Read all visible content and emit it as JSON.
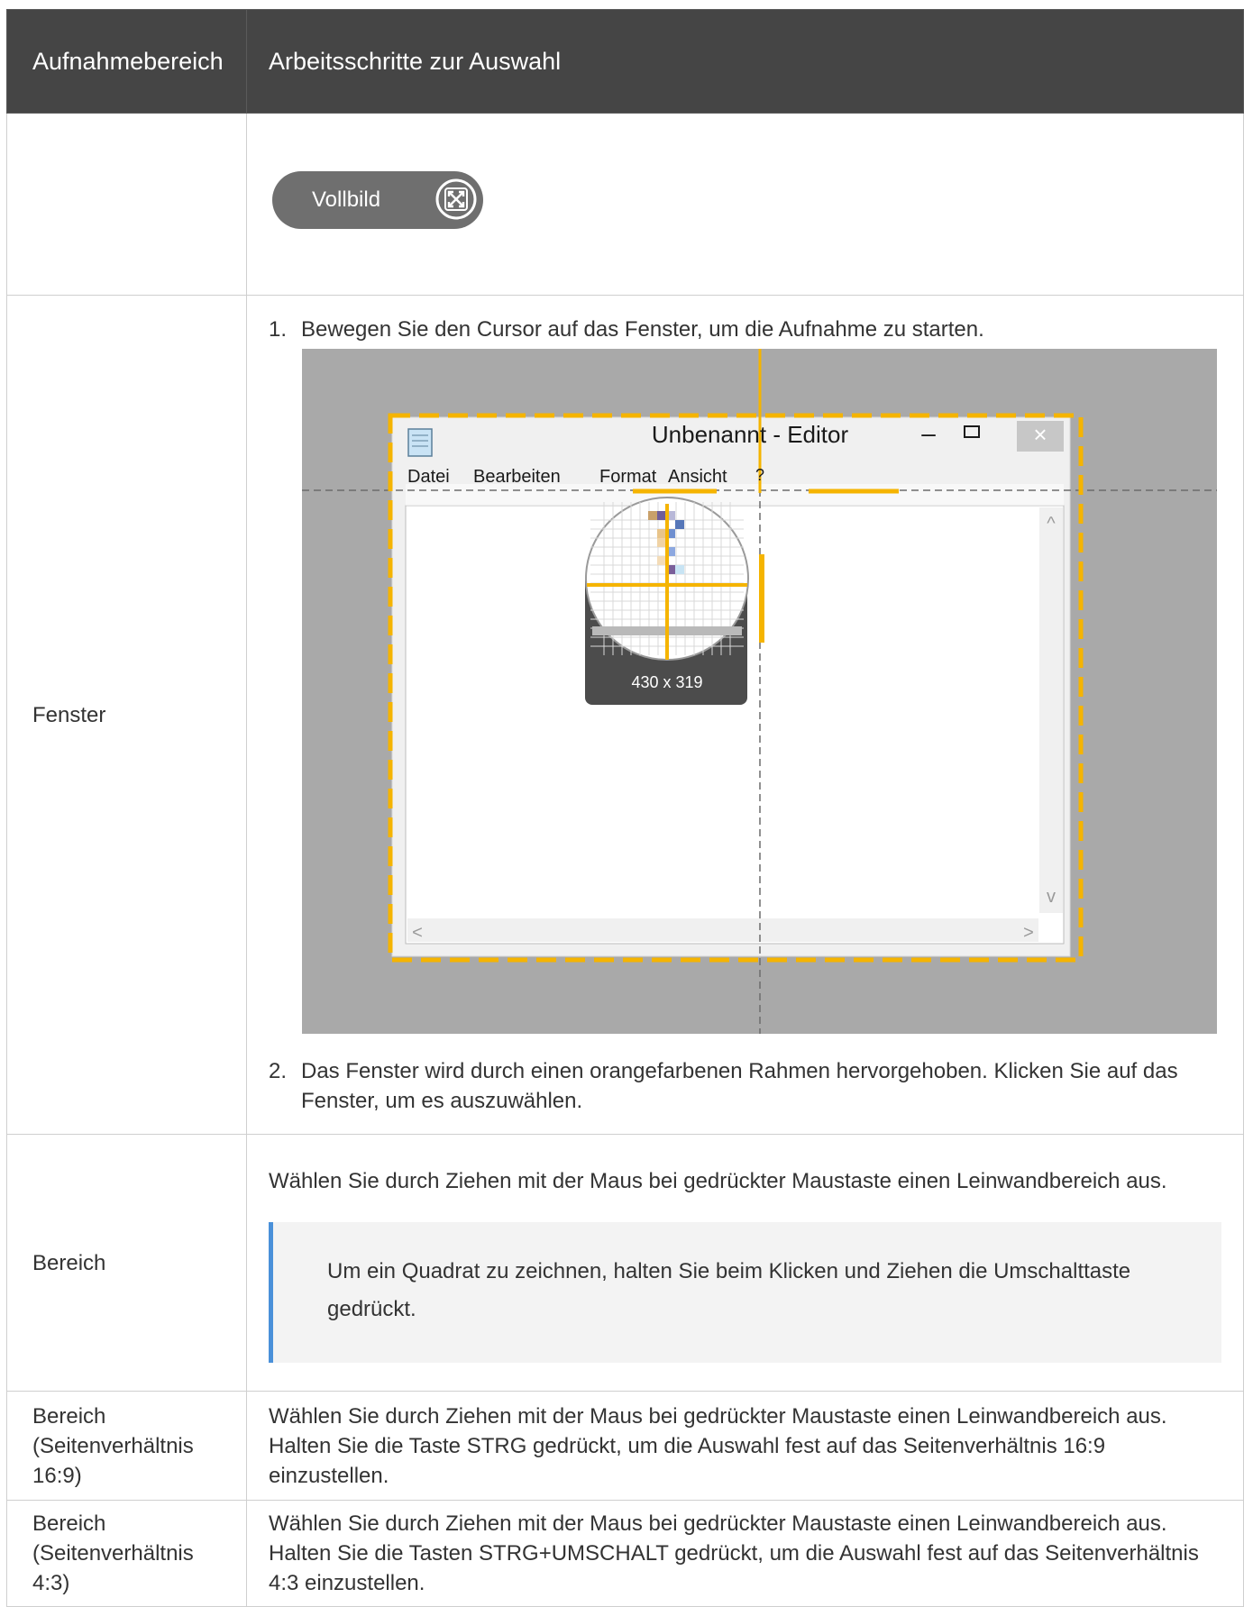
{
  "table": {
    "headers": {
      "area": "Aufnahmebereich",
      "steps": "Arbeitsschritte zur Auswahl"
    },
    "rows": {
      "full": {
        "area": "",
        "button_label": "Vollbild",
        "button_icon": "expand-arrows-icon"
      },
      "window": {
        "area": "Fenster",
        "step1_num": "1.",
        "step1": "Bewegen Sie den Cursor auf das Fenster, um die Aufnahme zu starten.",
        "step2_num": "2.",
        "step2": "Das Fenster wird durch einen orangefarbenen Rahmen hervorgehoben. Klicken Sie auf das Fenster, um es auszuwählen."
      },
      "area": {
        "area": "Bereich",
        "text": "Wählen Sie durch Ziehen mit der Maus bei gedrückter Maustaste einen Leinwandbereich aus.",
        "note": "Um ein Quadrat zu zeichnen, halten Sie beim Klicken und Ziehen die Umschalttaste gedrückt."
      },
      "ratio169": {
        "area": "Bereich (Seitenverhältnis 16:9)",
        "text": "Wählen Sie durch Ziehen mit der Maus bei gedrückter Maustaste einen Leinwandbereich aus. Halten Sie die Taste STRG gedrückt, um die Auswahl fest auf das Seitenverhältnis 16:9 einzustellen."
      },
      "ratio43": {
        "area": "Bereich (Seitenverhältnis 4:3)",
        "text": "Wählen Sie durch Ziehen mit der Maus bei gedrückter Maustaste einen Leinwandbereich aus. Halten Sie die Tasten STRG+UMSCHALT gedrückt, um die Auswahl fest auf das Seitenverhältnis 4:3 einzustellen."
      }
    }
  },
  "screenshot": {
    "window_title": "Unbenannt - Editor",
    "menu": [
      "Datei",
      "Bearbeiten",
      "Format",
      "Ansicht",
      "?"
    ],
    "magnifier_size": "430 x 319",
    "minimize_glyph": "–",
    "maximize_glyph": "☐",
    "close_glyph": "×",
    "scroll_up": "^",
    "scroll_down": "v",
    "scroll_left": "<",
    "scroll_right": ">",
    "colors": {
      "highlight": "#f5b400",
      "backdrop": "#a9a9a9",
      "window_bg": "#f0f0f0"
    }
  },
  "colors": {
    "header_bg": "#454545",
    "note_accent": "#4a90d9",
    "note_bg": "#f3f3f3"
  }
}
